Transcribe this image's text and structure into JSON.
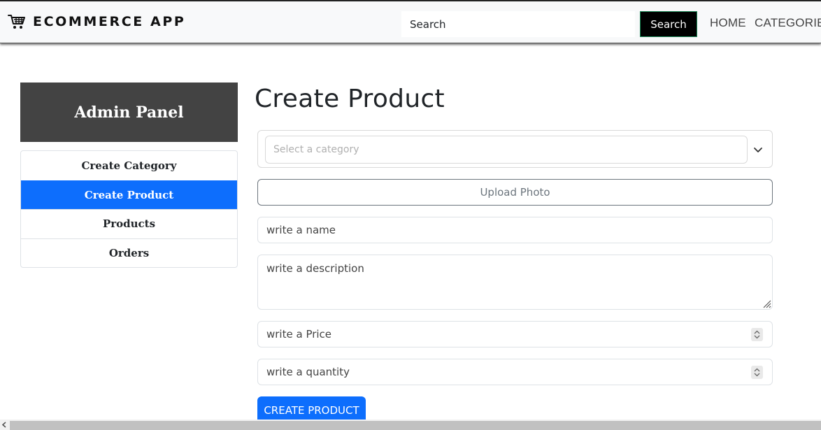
{
  "navbar": {
    "brand_icon": "shopping-cart-icon",
    "brand_text": "ECOMMERCE APP",
    "search_placeholder": "Search",
    "search_button": "Search",
    "links": [
      "HOME",
      "CATEGORIES"
    ]
  },
  "sidebar": {
    "title": "Admin Panel",
    "items": [
      {
        "label": "Create Category",
        "active": false
      },
      {
        "label": "Create Product",
        "active": true
      },
      {
        "label": "Products",
        "active": false
      },
      {
        "label": "Orders",
        "active": false
      }
    ]
  },
  "form": {
    "title": "Create Product",
    "category_placeholder": "Select a category",
    "upload_label": "Upload Photo",
    "name_placeholder": "write a name",
    "description_placeholder": "write a description",
    "price_placeholder": "write a Price",
    "quantity_placeholder": "write a quantity",
    "submit_label": "CREATE PRODUCT"
  },
  "colors": {
    "accent": "#0d6efd",
    "panel_header": "#434343",
    "navbar_bg": "#f8f9fa",
    "search_button_bg": "#000000"
  }
}
